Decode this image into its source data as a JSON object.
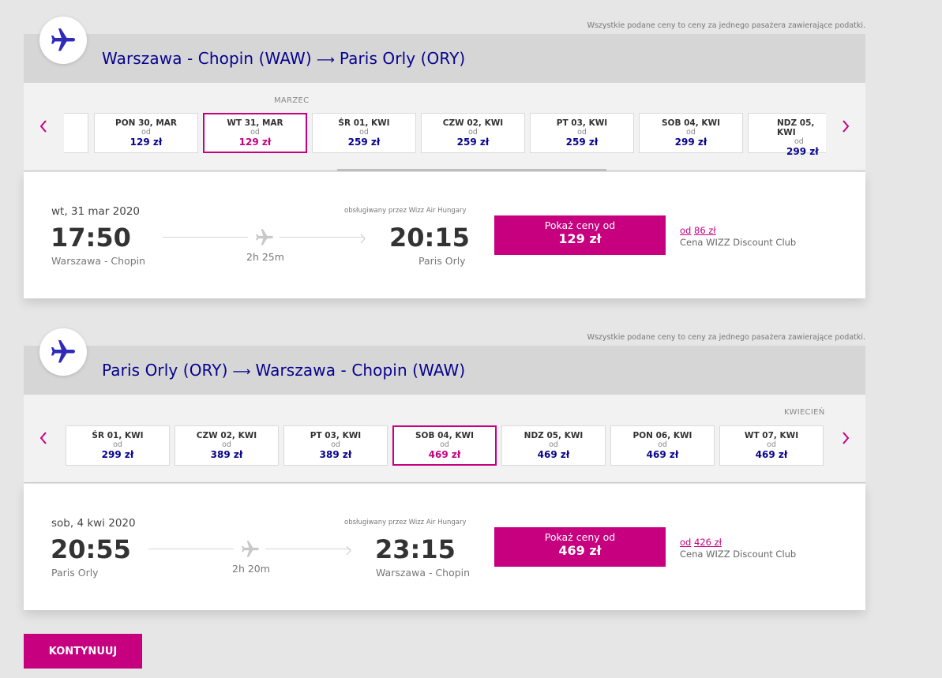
{
  "legs": [
    {
      "price_note": "Wszystkie podane ceny to ceny za jednego pasażera zawierające podatki.",
      "origin": "Warszawa - Chopin (WAW)",
      "arrow": "⟶",
      "destination": "Paris Orly (ORY)",
      "month_label": "MARZEC",
      "dates": [
        {
          "day": "PON 30, MAR",
          "from": "od",
          "price": "129 zł",
          "selected": false
        },
        {
          "day": "WT 31, MAR",
          "from": "od",
          "price": "129 zł",
          "selected": true
        },
        {
          "day": "ŚR 01, KWI",
          "from": "od",
          "price": "259 zł",
          "selected": false
        },
        {
          "day": "CZW 02, KWI",
          "from": "od",
          "price": "259 zł",
          "selected": false
        },
        {
          "day": "PT 03, KWI",
          "from": "od",
          "price": "259 zł",
          "selected": false
        },
        {
          "day": "SOB 04, KWI",
          "from": "od",
          "price": "299 zł",
          "selected": false
        },
        {
          "day": "NDZ 05, KWI",
          "from": "od",
          "price": "299 zł",
          "selected": false
        }
      ],
      "flight": {
        "date": "wt, 31 mar 2020",
        "operated_by": "obsługiwany przez Wizz Air Hungary",
        "dep_time": "17:50",
        "arr_time": "20:15",
        "dep_city": "Warszawa - Chopin",
        "arr_city": "Paris Orly",
        "duration": "2h 25m",
        "btn_label": "Pokaż ceny od",
        "btn_price": "129 zł",
        "wdc_prefix": "od",
        "wdc_price": "86 zł",
        "wdc_label": "Cena WIZZ Discount Club"
      }
    },
    {
      "price_note": "Wszystkie podane ceny to ceny za jednego pasażera zawierające podatki.",
      "origin": "Paris Orly (ORY)",
      "arrow": "⟶",
      "destination": "Warszawa - Chopin (WAW)",
      "month_label": "KWIECIEŃ",
      "dates": [
        {
          "day": "ŚR 01, KWI",
          "from": "od",
          "price": "299 zł",
          "selected": false
        },
        {
          "day": "CZW 02, KWI",
          "from": "od",
          "price": "389 zł",
          "selected": false
        },
        {
          "day": "PT 03, KWI",
          "from": "od",
          "price": "389 zł",
          "selected": false
        },
        {
          "day": "SOB 04, KWI",
          "from": "od",
          "price": "469 zł",
          "selected": true
        },
        {
          "day": "NDZ 05, KWI",
          "from": "od",
          "price": "469 zł",
          "selected": false
        },
        {
          "day": "PON 06, KWI",
          "from": "od",
          "price": "469 zł",
          "selected": false
        },
        {
          "day": "WT 07, KWI",
          "from": "od",
          "price": "469 zł",
          "selected": false
        }
      ],
      "flight": {
        "date": "sob, 4 kwi 2020",
        "operated_by": "obsługiwany przez Wizz Air Hungary",
        "dep_time": "20:55",
        "arr_time": "23:15",
        "dep_city": "Paris Orly",
        "arr_city": "Warszawa - Chopin",
        "duration": "2h 20m",
        "btn_label": "Pokaż ceny od",
        "btn_price": "469 zł",
        "wdc_prefix": "od",
        "wdc_price": "426 zł",
        "wdc_label": "Cena WIZZ Discount Club"
      }
    }
  ],
  "continue_label": "KONTYNUUJ",
  "colors": {
    "brand_magenta": "#c6007e",
    "brand_navy": "#06038d"
  },
  "icons": {
    "badge": "airplane-icon",
    "prev": "chevron-left-icon",
    "next": "chevron-right-icon",
    "route": "airplane-icon"
  }
}
